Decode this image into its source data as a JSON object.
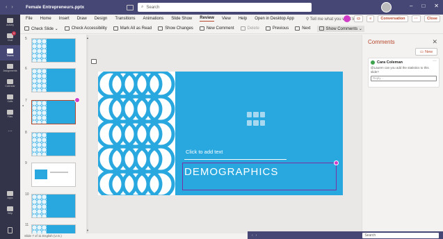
{
  "titlebar": {
    "file_name": "Female Entrepreneurs.pptx",
    "search_placeholder": "Search",
    "conversation_label": "Conversation",
    "close_label": "Close"
  },
  "rail": [
    {
      "label": "Activity",
      "icon": "bell-icon",
      "badge": ""
    },
    {
      "label": "Chat",
      "icon": "chat-icon",
      "badge": "1"
    },
    {
      "label": "Teams",
      "icon": "teams-icon",
      "badge": ""
    },
    {
      "label": "Assignments",
      "icon": "assignments-icon",
      "badge": ""
    },
    {
      "label": "Calendar",
      "icon": "calendar-icon",
      "badge": ""
    },
    {
      "label": "Calls",
      "icon": "phone-icon",
      "badge": ""
    },
    {
      "label": "Files",
      "icon": "files-icon",
      "badge": ""
    },
    {
      "label": "...",
      "icon": "more-icon",
      "badge": ""
    }
  ],
  "rail_bottom": [
    {
      "label": "Apps",
      "icon": "apps-icon"
    },
    {
      "label": "Help",
      "icon": "help-icon"
    }
  ],
  "menu": {
    "items": [
      "File",
      "Home",
      "Insert",
      "Draw",
      "Design",
      "Transitions",
      "Animations",
      "Slide Show",
      "Review",
      "View",
      "Help",
      "Open in Desktop App"
    ],
    "active": "Review",
    "tell_me": "Tell me what you want to do"
  },
  "ribbon": {
    "items": [
      {
        "label": "Check Slide ⌄",
        "disabled": false
      },
      {
        "label": "Check Accessibility",
        "disabled": false
      },
      {
        "label": "Mark All as Read",
        "disabled": false
      },
      {
        "label": "Show Changes",
        "disabled": false
      },
      {
        "label": "New Comment",
        "disabled": false
      },
      {
        "label": "Delete",
        "disabled": true
      },
      {
        "label": "Previous",
        "disabled": false
      },
      {
        "label": "Next",
        "disabled": false
      },
      {
        "label": "Show Comments ⌄",
        "disabled": false
      }
    ]
  },
  "thumbnails": [
    {
      "num": "5",
      "title": "",
      "style": "blue",
      "selected": false
    },
    {
      "num": "6",
      "title": "",
      "style": "blue",
      "selected": false
    },
    {
      "num": "7",
      "title": "",
      "style": "blue",
      "selected": true
    },
    {
      "num": "8",
      "title": "",
      "style": "blue",
      "selected": false
    },
    {
      "num": "9",
      "title": "",
      "style": "white",
      "selected": false
    },
    {
      "num": "10",
      "title": "",
      "style": "blue",
      "selected": false
    },
    {
      "num": "11",
      "title": "",
      "style": "blue",
      "selected": false
    }
  ],
  "slide": {
    "placeholder_text": "Click to add text",
    "title": "DEMOGRAPHICS"
  },
  "comments": {
    "heading": "Comments",
    "new_label": "New",
    "author": "Cara Coleman",
    "message": "@Lauren can you add the statistics to this slide?",
    "reply_placeholder": "Reply..."
  },
  "statusbar": {
    "text": "Slide 7 of 11   English (U.S.)"
  },
  "overlay": {
    "search_placeholder": "Search"
  },
  "colors": {
    "teams_purple": "#464775",
    "ppt_accent": "#b7472a",
    "slide_blue": "#29a8e0",
    "mention_pink": "#d13bc7"
  }
}
